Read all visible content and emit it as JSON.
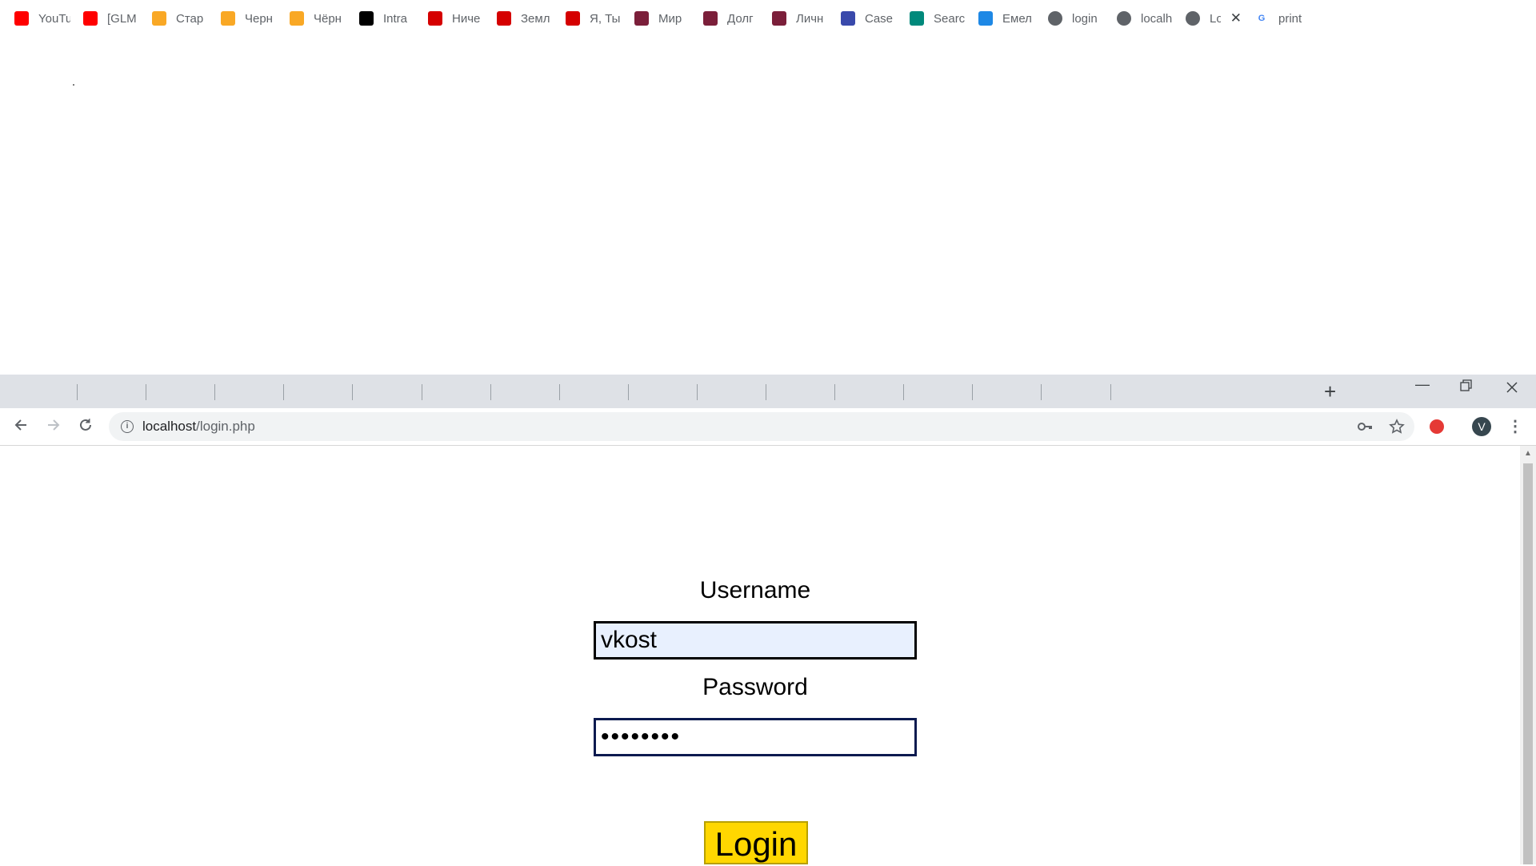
{
  "browser": {
    "tabs": [
      {
        "label": "YouTu",
        "icon": "youtube-icon",
        "color": "#ff0000"
      },
      {
        "label": "[GLM",
        "icon": "youtube-icon",
        "color": "#ff0000"
      },
      {
        "label": "Стар",
        "icon": "fs-icon",
        "color": "#f9a825"
      },
      {
        "label": "Черн",
        "icon": "fs-icon",
        "color": "#f9a825"
      },
      {
        "label": "Чёрн",
        "icon": "fs-icon",
        "color": "#f9a825"
      },
      {
        "label": "Intra",
        "icon": "42-icon",
        "color": "#000000"
      },
      {
        "label": "Ниче",
        "icon": "ki-icon",
        "color": "#d50000"
      },
      {
        "label": "Земл",
        "icon": "ki-icon",
        "color": "#d50000"
      },
      {
        "label": "Я, Ты",
        "icon": "ki-icon",
        "color": "#d50000"
      },
      {
        "label": "Мир",
        "icon": "book-icon",
        "color": "#7b1f3a"
      },
      {
        "label": "Долг",
        "icon": "book-icon",
        "color": "#7b1f3a"
      },
      {
        "label": "Личн",
        "icon": "book-icon",
        "color": "#7b1f3a"
      },
      {
        "label": "Case",
        "icon": "seal-icon",
        "color": "#3949ab"
      },
      {
        "label": "Searc",
        "icon": "gauge-icon",
        "color": "#00897b"
      },
      {
        "label": "Емел",
        "icon": "speaker-icon",
        "color": "#1e88e5"
      },
      {
        "label": "login",
        "icon": "globe-icon",
        "color": "#5f6368"
      },
      {
        "label": "localh",
        "icon": "globe-icon",
        "color": "#5f6368"
      },
      {
        "label": "Lo",
        "icon": "globe-icon",
        "color": "#5f6368",
        "active": true
      },
      {
        "label": "print",
        "icon": "google-icon",
        "color": "#4285f4"
      }
    ],
    "url_host": "localhost",
    "url_path": "/login.php",
    "avatar_letter": "V",
    "new_tab": "+",
    "close_tab": "✕"
  },
  "form": {
    "username_label": "Username",
    "username_value": "vkost",
    "password_label": "Password",
    "password_value": "••••••••",
    "login_label": "Login"
  }
}
